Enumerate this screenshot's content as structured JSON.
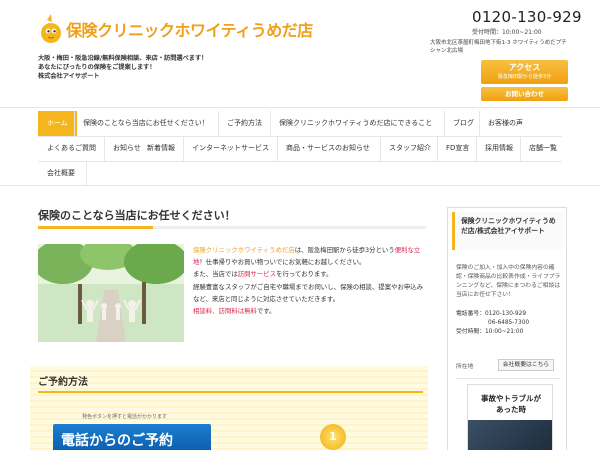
{
  "header": {
    "logo_text": "保険クリニックホワイティうめだ店",
    "tagline_lines": [
      "大阪・梅田・阪急沿線/無料保険相談、来店・訪問選べます！",
      "あなたにぴったりの保険をご提案します！",
      "株式会社アイサポート"
    ],
    "phone": "0120-130-929",
    "hours": "受付時間：10:00~21:00",
    "address": "大阪市北区茶屋町梅田地下街1-3 ホワイティうめだプチシャン北広場",
    "access_label": "アクセス",
    "access_sub": "阪急梅田駅から徒歩3分",
    "contact_label": "お問い合わせ"
  },
  "nav": {
    "row1": [
      "ホーム",
      "保険のことなら当店にお任せください！",
      "ご予約方法",
      "保険クリニックホワイティうめだ店にできること",
      "ブログ",
      "お客様の声"
    ],
    "row2": [
      "よくあるご質問",
      "お知らせ",
      "新着情報",
      "インターネットサービス",
      "商品・サービスのお知らせ",
      "スタッフ紹介",
      "FD宣言",
      "採用情報",
      "店舗一覧"
    ],
    "row3": [
      "会社概要"
    ],
    "active": "ホーム"
  },
  "main": {
    "title": "保険のことなら当店にお任せください！",
    "intro": {
      "line1_org": "保険クリニックホワイティうめだ店",
      "line1_rest": "は、阪急梅田駅から徒歩3分という",
      "line2_red": "便利な立地",
      "line2_rest": "！仕事帰りやお買い物ついでにお気軽にお越しください。",
      "line3_a": "また、当店では",
      "line3_red": "訪問サービス",
      "line3_b": "を行っております。",
      "line4": "経験豊富なスタッフがご自宅や職場までお伺いし、保険の相談、提案やお申込みなど、来店と同じように対応させていただきます。",
      "line5_red": "相談料、訪問料は無料",
      "line5_rest": "です。"
    },
    "reserve": {
      "title": "ご予約方法",
      "note": "発色ボタンを押すと電話がかかります",
      "phone_banner": "電話からのご予約",
      "step": "1"
    }
  },
  "sidebar": {
    "title": "保険クリニックホワイティうめだ店/株式会社アイサポート",
    "description": "保険のご加入・加入中の保険内容の確認・保険商品の比較表作成・ライフプランニングなど、保険にまつわるご相談は当店にお任せ下さい！",
    "phone_label": "電話番号：0120-130-929",
    "phone2": "06-6485-7300",
    "hours": "受付時間：10:00~21:00",
    "location_label": "所在地",
    "company_button": "会社概要はこちら",
    "banner_text_1": "事故やトラブルが",
    "banner_text_2": "あった時"
  },
  "colors": {
    "accent": "#f5b51c",
    "logo": "#f0a018",
    "highlight_red": "#d5294f",
    "phone_banner_blue": "#1d7dd0"
  }
}
